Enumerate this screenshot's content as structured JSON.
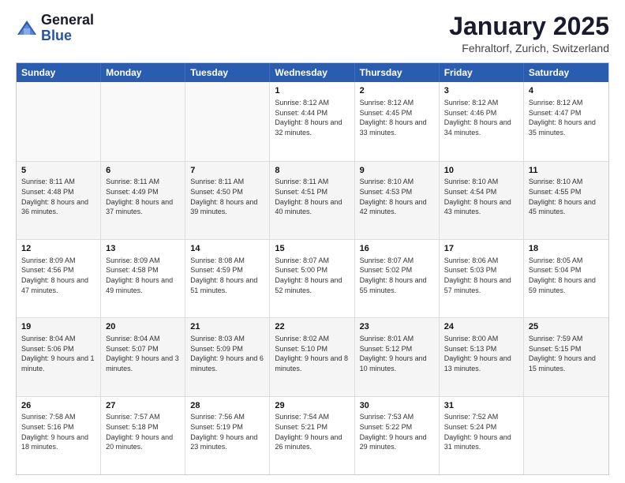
{
  "header": {
    "logo_general": "General",
    "logo_blue": "Blue",
    "month_title": "January 2025",
    "location": "Fehraltorf, Zurich, Switzerland"
  },
  "days_of_week": [
    "Sunday",
    "Monday",
    "Tuesday",
    "Wednesday",
    "Thursday",
    "Friday",
    "Saturday"
  ],
  "weeks": [
    [
      {
        "day": "",
        "detail": ""
      },
      {
        "day": "",
        "detail": ""
      },
      {
        "day": "",
        "detail": ""
      },
      {
        "day": "1",
        "detail": "Sunrise: 8:12 AM\nSunset: 4:44 PM\nDaylight: 8 hours and 32 minutes."
      },
      {
        "day": "2",
        "detail": "Sunrise: 8:12 AM\nSunset: 4:45 PM\nDaylight: 8 hours and 33 minutes."
      },
      {
        "day": "3",
        "detail": "Sunrise: 8:12 AM\nSunset: 4:46 PM\nDaylight: 8 hours and 34 minutes."
      },
      {
        "day": "4",
        "detail": "Sunrise: 8:12 AM\nSunset: 4:47 PM\nDaylight: 8 hours and 35 minutes."
      }
    ],
    [
      {
        "day": "5",
        "detail": "Sunrise: 8:11 AM\nSunset: 4:48 PM\nDaylight: 8 hours and 36 minutes."
      },
      {
        "day": "6",
        "detail": "Sunrise: 8:11 AM\nSunset: 4:49 PM\nDaylight: 8 hours and 37 minutes."
      },
      {
        "day": "7",
        "detail": "Sunrise: 8:11 AM\nSunset: 4:50 PM\nDaylight: 8 hours and 39 minutes."
      },
      {
        "day": "8",
        "detail": "Sunrise: 8:11 AM\nSunset: 4:51 PM\nDaylight: 8 hours and 40 minutes."
      },
      {
        "day": "9",
        "detail": "Sunrise: 8:10 AM\nSunset: 4:53 PM\nDaylight: 8 hours and 42 minutes."
      },
      {
        "day": "10",
        "detail": "Sunrise: 8:10 AM\nSunset: 4:54 PM\nDaylight: 8 hours and 43 minutes."
      },
      {
        "day": "11",
        "detail": "Sunrise: 8:10 AM\nSunset: 4:55 PM\nDaylight: 8 hours and 45 minutes."
      }
    ],
    [
      {
        "day": "12",
        "detail": "Sunrise: 8:09 AM\nSunset: 4:56 PM\nDaylight: 8 hours and 47 minutes."
      },
      {
        "day": "13",
        "detail": "Sunrise: 8:09 AM\nSunset: 4:58 PM\nDaylight: 8 hours and 49 minutes."
      },
      {
        "day": "14",
        "detail": "Sunrise: 8:08 AM\nSunset: 4:59 PM\nDaylight: 8 hours and 51 minutes."
      },
      {
        "day": "15",
        "detail": "Sunrise: 8:07 AM\nSunset: 5:00 PM\nDaylight: 8 hours and 52 minutes."
      },
      {
        "day": "16",
        "detail": "Sunrise: 8:07 AM\nSunset: 5:02 PM\nDaylight: 8 hours and 55 minutes."
      },
      {
        "day": "17",
        "detail": "Sunrise: 8:06 AM\nSunset: 5:03 PM\nDaylight: 8 hours and 57 minutes."
      },
      {
        "day": "18",
        "detail": "Sunrise: 8:05 AM\nSunset: 5:04 PM\nDaylight: 8 hours and 59 minutes."
      }
    ],
    [
      {
        "day": "19",
        "detail": "Sunrise: 8:04 AM\nSunset: 5:06 PM\nDaylight: 9 hours and 1 minute."
      },
      {
        "day": "20",
        "detail": "Sunrise: 8:04 AM\nSunset: 5:07 PM\nDaylight: 9 hours and 3 minutes."
      },
      {
        "day": "21",
        "detail": "Sunrise: 8:03 AM\nSunset: 5:09 PM\nDaylight: 9 hours and 6 minutes."
      },
      {
        "day": "22",
        "detail": "Sunrise: 8:02 AM\nSunset: 5:10 PM\nDaylight: 9 hours and 8 minutes."
      },
      {
        "day": "23",
        "detail": "Sunrise: 8:01 AM\nSunset: 5:12 PM\nDaylight: 9 hours and 10 minutes."
      },
      {
        "day": "24",
        "detail": "Sunrise: 8:00 AM\nSunset: 5:13 PM\nDaylight: 9 hours and 13 minutes."
      },
      {
        "day": "25",
        "detail": "Sunrise: 7:59 AM\nSunset: 5:15 PM\nDaylight: 9 hours and 15 minutes."
      }
    ],
    [
      {
        "day": "26",
        "detail": "Sunrise: 7:58 AM\nSunset: 5:16 PM\nDaylight: 9 hours and 18 minutes."
      },
      {
        "day": "27",
        "detail": "Sunrise: 7:57 AM\nSunset: 5:18 PM\nDaylight: 9 hours and 20 minutes."
      },
      {
        "day": "28",
        "detail": "Sunrise: 7:56 AM\nSunset: 5:19 PM\nDaylight: 9 hours and 23 minutes."
      },
      {
        "day": "29",
        "detail": "Sunrise: 7:54 AM\nSunset: 5:21 PM\nDaylight: 9 hours and 26 minutes."
      },
      {
        "day": "30",
        "detail": "Sunrise: 7:53 AM\nSunset: 5:22 PM\nDaylight: 9 hours and 29 minutes."
      },
      {
        "day": "31",
        "detail": "Sunrise: 7:52 AM\nSunset: 5:24 PM\nDaylight: 9 hours and 31 minutes."
      },
      {
        "day": "",
        "detail": ""
      }
    ]
  ]
}
